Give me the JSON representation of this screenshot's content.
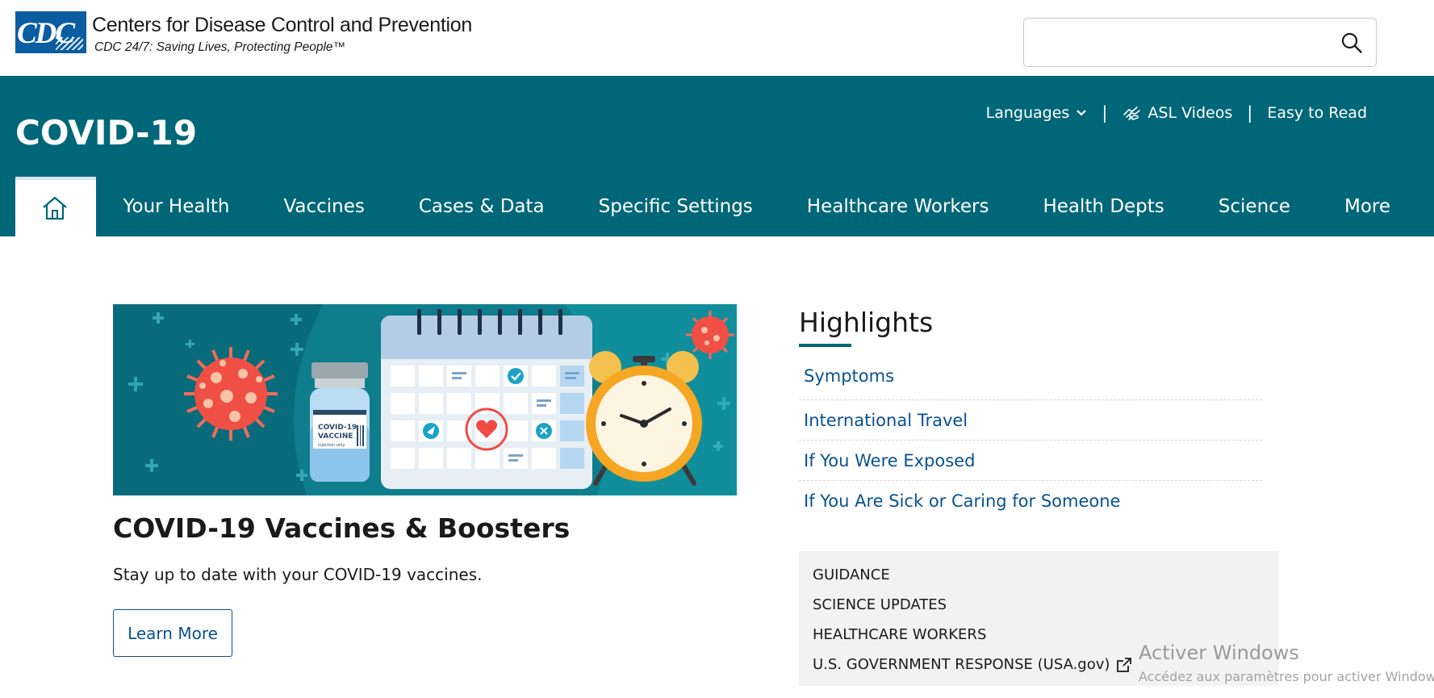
{
  "header": {
    "logo_text": "CDC",
    "org_name": "Centers for Disease Control and Prevention",
    "tagline": "CDC 24/7: Saving Lives, Protecting People™",
    "search": {
      "placeholder": "",
      "value": "",
      "icon": "search-icon"
    }
  },
  "site": {
    "title": "COVID-19",
    "utility": {
      "languages": "Languages",
      "separator": "|",
      "asl": "ASL Videos",
      "easy_read": "Easy to Read"
    }
  },
  "nav": {
    "home_icon": "home-icon",
    "items": [
      "Your Health",
      "Vaccines",
      "Cases & Data",
      "Specific Settings",
      "Healthcare Workers",
      "Health Depts",
      "Science",
      "More"
    ]
  },
  "feature": {
    "vial_label_1": "COVID-19",
    "vial_label_2": "VACCINE",
    "vial_label_3": "injection only",
    "title": "COVID-19 Vaccines & Boosters",
    "text": "Stay up to date with your COVID-19 vaccines.",
    "button": "Learn More"
  },
  "highlights": {
    "title": "Highlights",
    "links": [
      "Symptoms",
      "International Travel",
      "If You Were Exposed",
      "If You Are Sick or Caring for Someone"
    ]
  },
  "guidance": {
    "links": [
      "GUIDANCE",
      "SCIENCE UPDATES",
      "HEALTHCARE WORKERS",
      "U.S. GOVERNMENT RESPONSE (USA.gov)"
    ],
    "external_icon": "external-link-icon"
  },
  "watermark": {
    "title": "Activer Windows",
    "subtitle": "Accédez aux paramètres pour activer Windows."
  },
  "colors": {
    "teal": "#006778",
    "link_blue": "#075290",
    "logo_blue": "#0b5da2",
    "panel_gray": "#f2f2f2"
  }
}
